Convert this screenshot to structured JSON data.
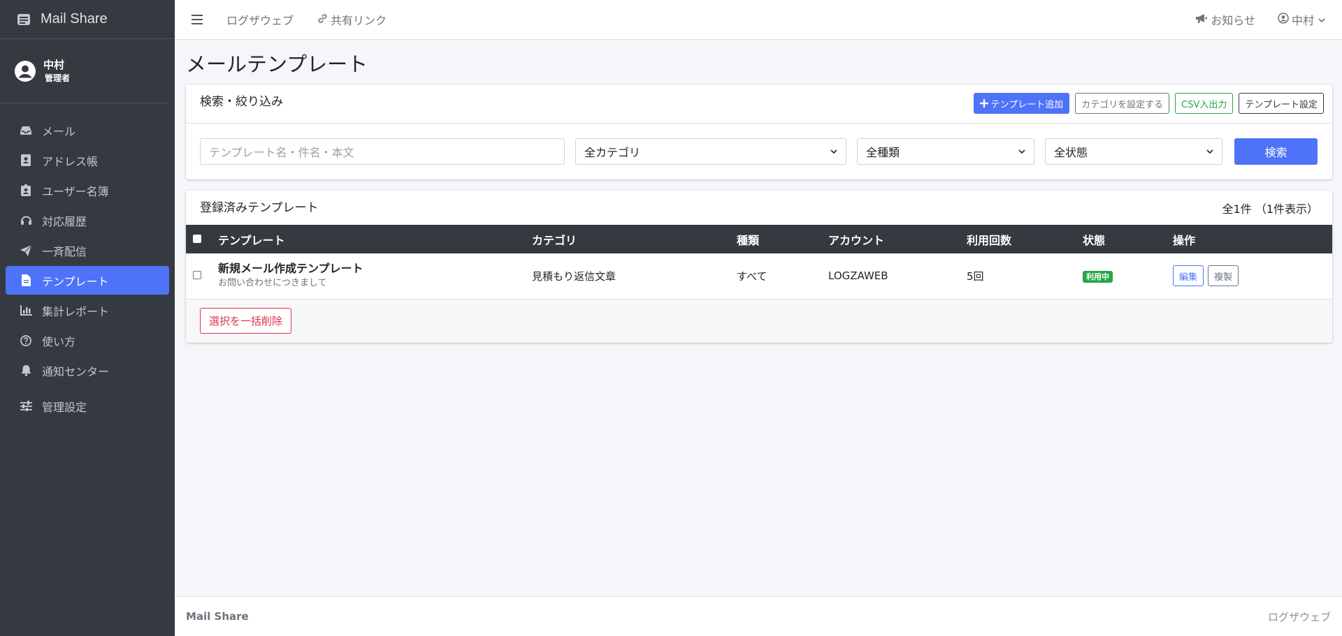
{
  "app": {
    "brand": "Mail Share"
  },
  "user": {
    "name": "中村",
    "role": "管理者"
  },
  "sidebar": {
    "items": [
      {
        "label": "メール",
        "icon": "inbox-icon"
      },
      {
        "label": "アドレス帳",
        "icon": "address-book-icon"
      },
      {
        "label": "ユーザー名簿",
        "icon": "id-badge-icon"
      },
      {
        "label": "対応履歴",
        "icon": "headset-icon"
      },
      {
        "label": "一斉配信",
        "icon": "paper-plane-icon"
      },
      {
        "label": "テンプレート",
        "icon": "file-icon",
        "active": true
      },
      {
        "label": "集計レポート",
        "icon": "chart-bar-icon"
      },
      {
        "label": "使い方",
        "icon": "question-circle-icon"
      },
      {
        "label": "通知センター",
        "icon": "bell-icon"
      },
      {
        "label": "管理設定",
        "icon": "sliders-icon"
      }
    ]
  },
  "topbar": {
    "link1": "ログザウェブ",
    "link2": "共有リンク",
    "notice": "お知らせ",
    "user": "中村"
  },
  "page": {
    "title": "メールテンプレート"
  },
  "search": {
    "title": "検索・絞り込み",
    "add_button": "テンプレート追加",
    "category_button": "カテゴリを設定する",
    "csv_button": "CSV入出力",
    "settings_button": "テンプレート設定",
    "keyword_placeholder": "テンプレート名・件名・本文",
    "category_select": "全カテゴリ",
    "type_select": "全種類",
    "status_select": "全状態",
    "search_button": "検索"
  },
  "list": {
    "title": "登録済みテンプレート",
    "count": "全1件 （1件表示）",
    "columns": [
      "テンプレート",
      "カテゴリ",
      "種類",
      "アカウント",
      "利用回数",
      "状態",
      "操作"
    ],
    "rows": [
      {
        "name": "新規メール作成テンプレート",
        "subject": "お問い合わせにつきまして",
        "category": "見積もり返信文章",
        "type": "すべて",
        "account": "LOGZAWEB",
        "uses": "5回",
        "status": "利用中",
        "edit": "編集",
        "copy": "複製"
      }
    ],
    "bulk_delete": "選択を一括削除"
  },
  "footer": {
    "brand": "Mail Share",
    "right": "ログザウェブ"
  },
  "colors": {
    "primary": "#4e73f8",
    "sidebar": "#343a40",
    "success": "#28a745",
    "danger": "#dc3545"
  }
}
